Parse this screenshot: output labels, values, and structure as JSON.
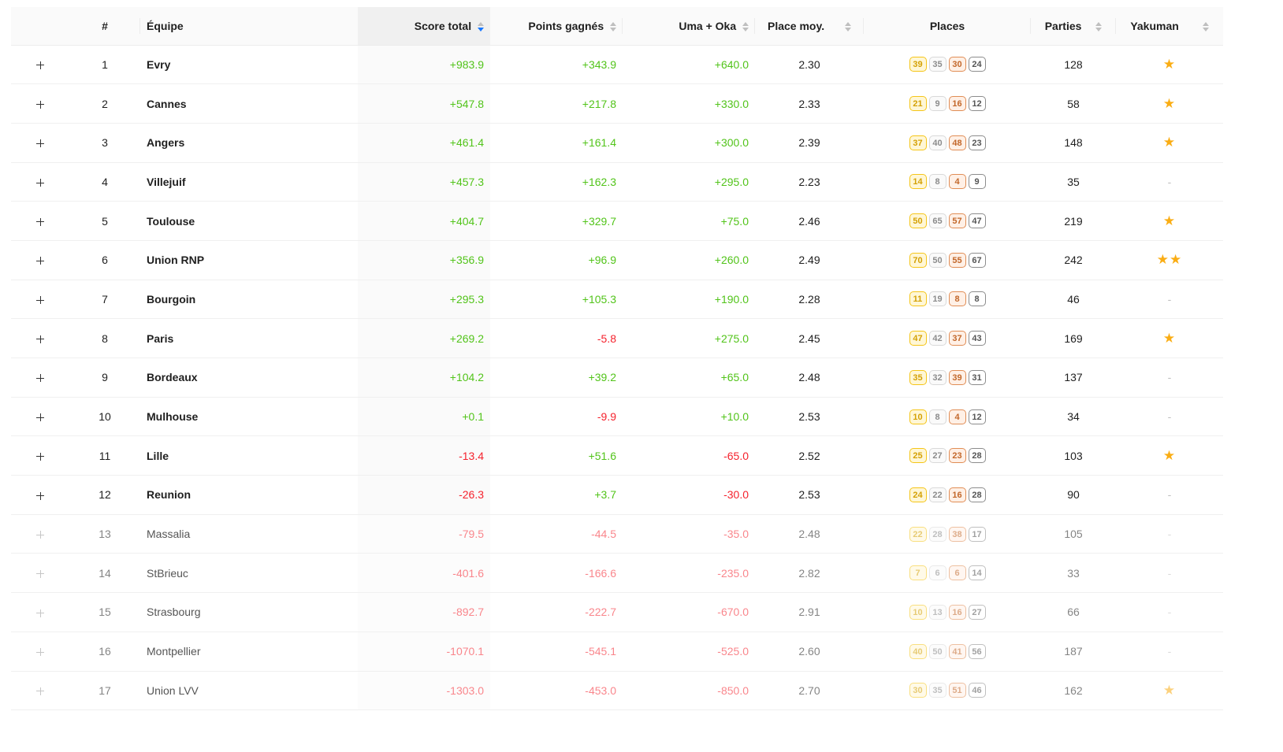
{
  "headers": {
    "expand": "",
    "rank": "#",
    "team": "Équipe",
    "score": "Score total",
    "points": "Points gagnés",
    "uma": "Uma + Oka",
    "place": "Place moy.",
    "places": "Places",
    "games": "Parties",
    "yakuman": "Yakuman"
  },
  "colors": {
    "positive": "#52c41a",
    "negative": "#f5222d",
    "sort_active": "#1677ff",
    "first_place": "#f5c518",
    "second_place": "#d9d9d9",
    "third_place": "#e08d55",
    "fourth_place": "#8c8c8c",
    "star": "#faad14"
  },
  "rows": [
    {
      "rank": "1",
      "team": "Evry",
      "score": "+983.9",
      "points": "+343.9",
      "uma": "+640.0",
      "place": "2.30",
      "p1": "39",
      "p2": "35",
      "p3": "30",
      "p4": "24",
      "games": "128",
      "yakuman": "★"
    },
    {
      "rank": "2",
      "team": "Cannes",
      "score": "+547.8",
      "points": "+217.8",
      "uma": "+330.0",
      "place": "2.33",
      "p1": "21",
      "p2": "9",
      "p3": "16",
      "p4": "12",
      "games": "58",
      "yakuman": "★"
    },
    {
      "rank": "3",
      "team": "Angers",
      "score": "+461.4",
      "points": "+161.4",
      "uma": "+300.0",
      "place": "2.39",
      "p1": "37",
      "p2": "40",
      "p3": "48",
      "p4": "23",
      "games": "148",
      "yakuman": "★"
    },
    {
      "rank": "4",
      "team": "Villejuif",
      "score": "+457.3",
      "points": "+162.3",
      "uma": "+295.0",
      "place": "2.23",
      "p1": "14",
      "p2": "8",
      "p3": "4",
      "p4": "9",
      "games": "35",
      "yakuman": "-"
    },
    {
      "rank": "5",
      "team": "Toulouse",
      "score": "+404.7",
      "points": "+329.7",
      "uma": "+75.0",
      "place": "2.46",
      "p1": "50",
      "p2": "65",
      "p3": "57",
      "p4": "47",
      "games": "219",
      "yakuman": "★"
    },
    {
      "rank": "6",
      "team": "Union RNP",
      "score": "+356.9",
      "points": "+96.9",
      "uma": "+260.0",
      "place": "2.49",
      "p1": "70",
      "p2": "50",
      "p3": "55",
      "p4": "67",
      "games": "242",
      "yakuman": "★★"
    },
    {
      "rank": "7",
      "team": "Bourgoin",
      "score": "+295.3",
      "points": "+105.3",
      "uma": "+190.0",
      "place": "2.28",
      "p1": "11",
      "p2": "19",
      "p3": "8",
      "p4": "8",
      "games": "46",
      "yakuman": "-"
    },
    {
      "rank": "8",
      "team": "Paris",
      "score": "+269.2",
      "points": "-5.8",
      "uma": "+275.0",
      "place": "2.45",
      "p1": "47",
      "p2": "42",
      "p3": "37",
      "p4": "43",
      "games": "169",
      "yakuman": "★"
    },
    {
      "rank": "9",
      "team": "Bordeaux",
      "score": "+104.2",
      "points": "+39.2",
      "uma": "+65.0",
      "place": "2.48",
      "p1": "35",
      "p2": "32",
      "p3": "39",
      "p4": "31",
      "games": "137",
      "yakuman": "-"
    },
    {
      "rank": "10",
      "team": "Mulhouse",
      "score": "+0.1",
      "points": "-9.9",
      "uma": "+10.0",
      "place": "2.53",
      "p1": "10",
      "p2": "8",
      "p3": "4",
      "p4": "12",
      "games": "34",
      "yakuman": "-"
    },
    {
      "rank": "11",
      "team": "Lille",
      "score": "-13.4",
      "points": "+51.6",
      "uma": "-65.0",
      "place": "2.52",
      "p1": "25",
      "p2": "27",
      "p3": "23",
      "p4": "28",
      "games": "103",
      "yakuman": "★"
    },
    {
      "rank": "12",
      "team": "Reunion",
      "score": "-26.3",
      "points": "+3.7",
      "uma": "-30.0",
      "place": "2.53",
      "p1": "24",
      "p2": "22",
      "p3": "16",
      "p4": "28",
      "games": "90",
      "yakuman": "-"
    },
    {
      "rank": "13",
      "team": "Massalia",
      "score": "-79.5",
      "points": "-44.5",
      "uma": "-35.0",
      "place": "2.48",
      "p1": "22",
      "p2": "28",
      "p3": "38",
      "p4": "17",
      "games": "105",
      "yakuman": "-"
    },
    {
      "rank": "14",
      "team": "StBrieuc",
      "score": "-401.6",
      "points": "-166.6",
      "uma": "-235.0",
      "place": "2.82",
      "p1": "7",
      "p2": "6",
      "p3": "6",
      "p4": "14",
      "games": "33",
      "yakuman": "-"
    },
    {
      "rank": "15",
      "team": "Strasbourg",
      "score": "-892.7",
      "points": "-222.7",
      "uma": "-670.0",
      "place": "2.91",
      "p1": "10",
      "p2": "13",
      "p3": "16",
      "p4": "27",
      "games": "66",
      "yakuman": "-"
    },
    {
      "rank": "16",
      "team": "Montpellier",
      "score": "-1070.1",
      "points": "-545.1",
      "uma": "-525.0",
      "place": "2.60",
      "p1": "40",
      "p2": "50",
      "p3": "41",
      "p4": "56",
      "games": "187",
      "yakuman": "-"
    },
    {
      "rank": "17",
      "team": "Union LVV",
      "score": "-1303.0",
      "points": "-453.0",
      "uma": "-850.0",
      "place": "2.70",
      "p1": "30",
      "p2": "35",
      "p3": "51",
      "p4": "46",
      "games": "162",
      "yakuman": "★"
    }
  ],
  "faded_from_rank": 13
}
